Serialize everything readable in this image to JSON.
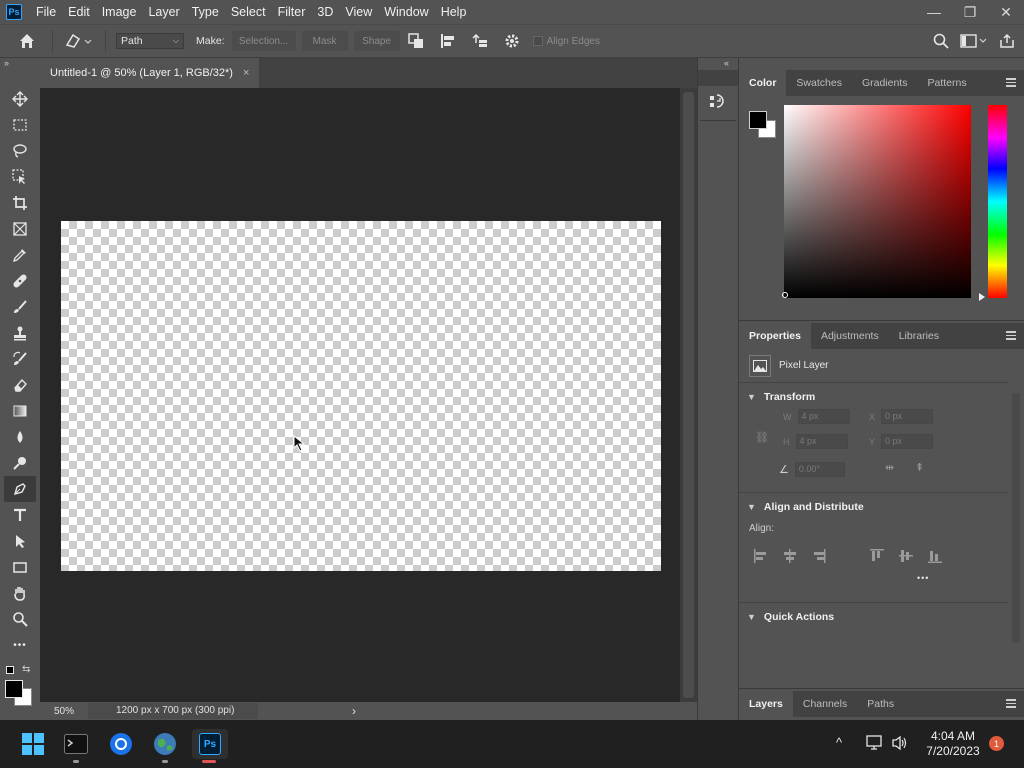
{
  "app": {
    "logo_text": "Ps",
    "menu": [
      "File",
      "Edit",
      "Image",
      "Layer",
      "Type",
      "Select",
      "Filter",
      "3D",
      "View",
      "Window",
      "Help"
    ],
    "window_controls": {
      "minimize": "—",
      "restore": "❐",
      "close": "✕"
    }
  },
  "options_bar": {
    "mode_value": "Path",
    "make_label": "Make:",
    "selection_btn": "Selection...",
    "mask_btn": "Mask",
    "shape_btn": "Shape",
    "align_edges_label": "Align Edges"
  },
  "collapse_left": "»",
  "collapse_right": "«",
  "document": {
    "tab_title": "Untitled-1 @ 50% (Layer 1, RGB/32*)",
    "tab_close": "×",
    "zoom": "50%",
    "info": "1200 px x 700 px (300 ppi)",
    "info_arrow": "›"
  },
  "toolbar": {
    "tools": [
      "move-icon",
      "marquee-icon",
      "lasso-icon",
      "object-select-icon",
      "crop-icon",
      "frame-icon",
      "eyedropper-icon",
      "healing-icon",
      "brush-icon",
      "stamp-icon",
      "history-brush-icon",
      "eraser-icon",
      "gradient-icon",
      "blur-icon",
      "dodge-icon",
      "pen-icon",
      "type-icon",
      "path-select-icon",
      "rectangle-icon",
      "hand-icon",
      "zoom-icon",
      "more-icon"
    ],
    "active_tool": "pen-icon",
    "more_label": "•••"
  },
  "color_panel": {
    "tabs": [
      "Color",
      "Swatches",
      "Gradients",
      "Patterns"
    ],
    "active_tab": "Color",
    "foreground": "#000000",
    "background": "#ffffff",
    "hue": "#ff0000"
  },
  "properties_panel": {
    "tabs": [
      "Properties",
      "Adjustments",
      "Libraries"
    ],
    "active_tab": "Properties",
    "layer_type": "Pixel Layer",
    "transform_title": "Transform",
    "w_label": "W",
    "w_value": "4 px",
    "h_label": "H",
    "h_value": "4 px",
    "x_label": "X",
    "x_value": "0 px",
    "y_label": "Y",
    "y_value": "0 px",
    "angle_value": "0.00°",
    "align_title": "Align and Distribute",
    "align_label": "Align:",
    "more_label": "•••",
    "quick_actions_title": "Quick Actions"
  },
  "layers_panel": {
    "tabs": [
      "Layers",
      "Channels",
      "Paths"
    ],
    "active_tab": "Layers"
  },
  "taskbar": {
    "time": "4:04 AM",
    "date": "7/20/2023",
    "notification_count": "1",
    "chevron": "^"
  }
}
